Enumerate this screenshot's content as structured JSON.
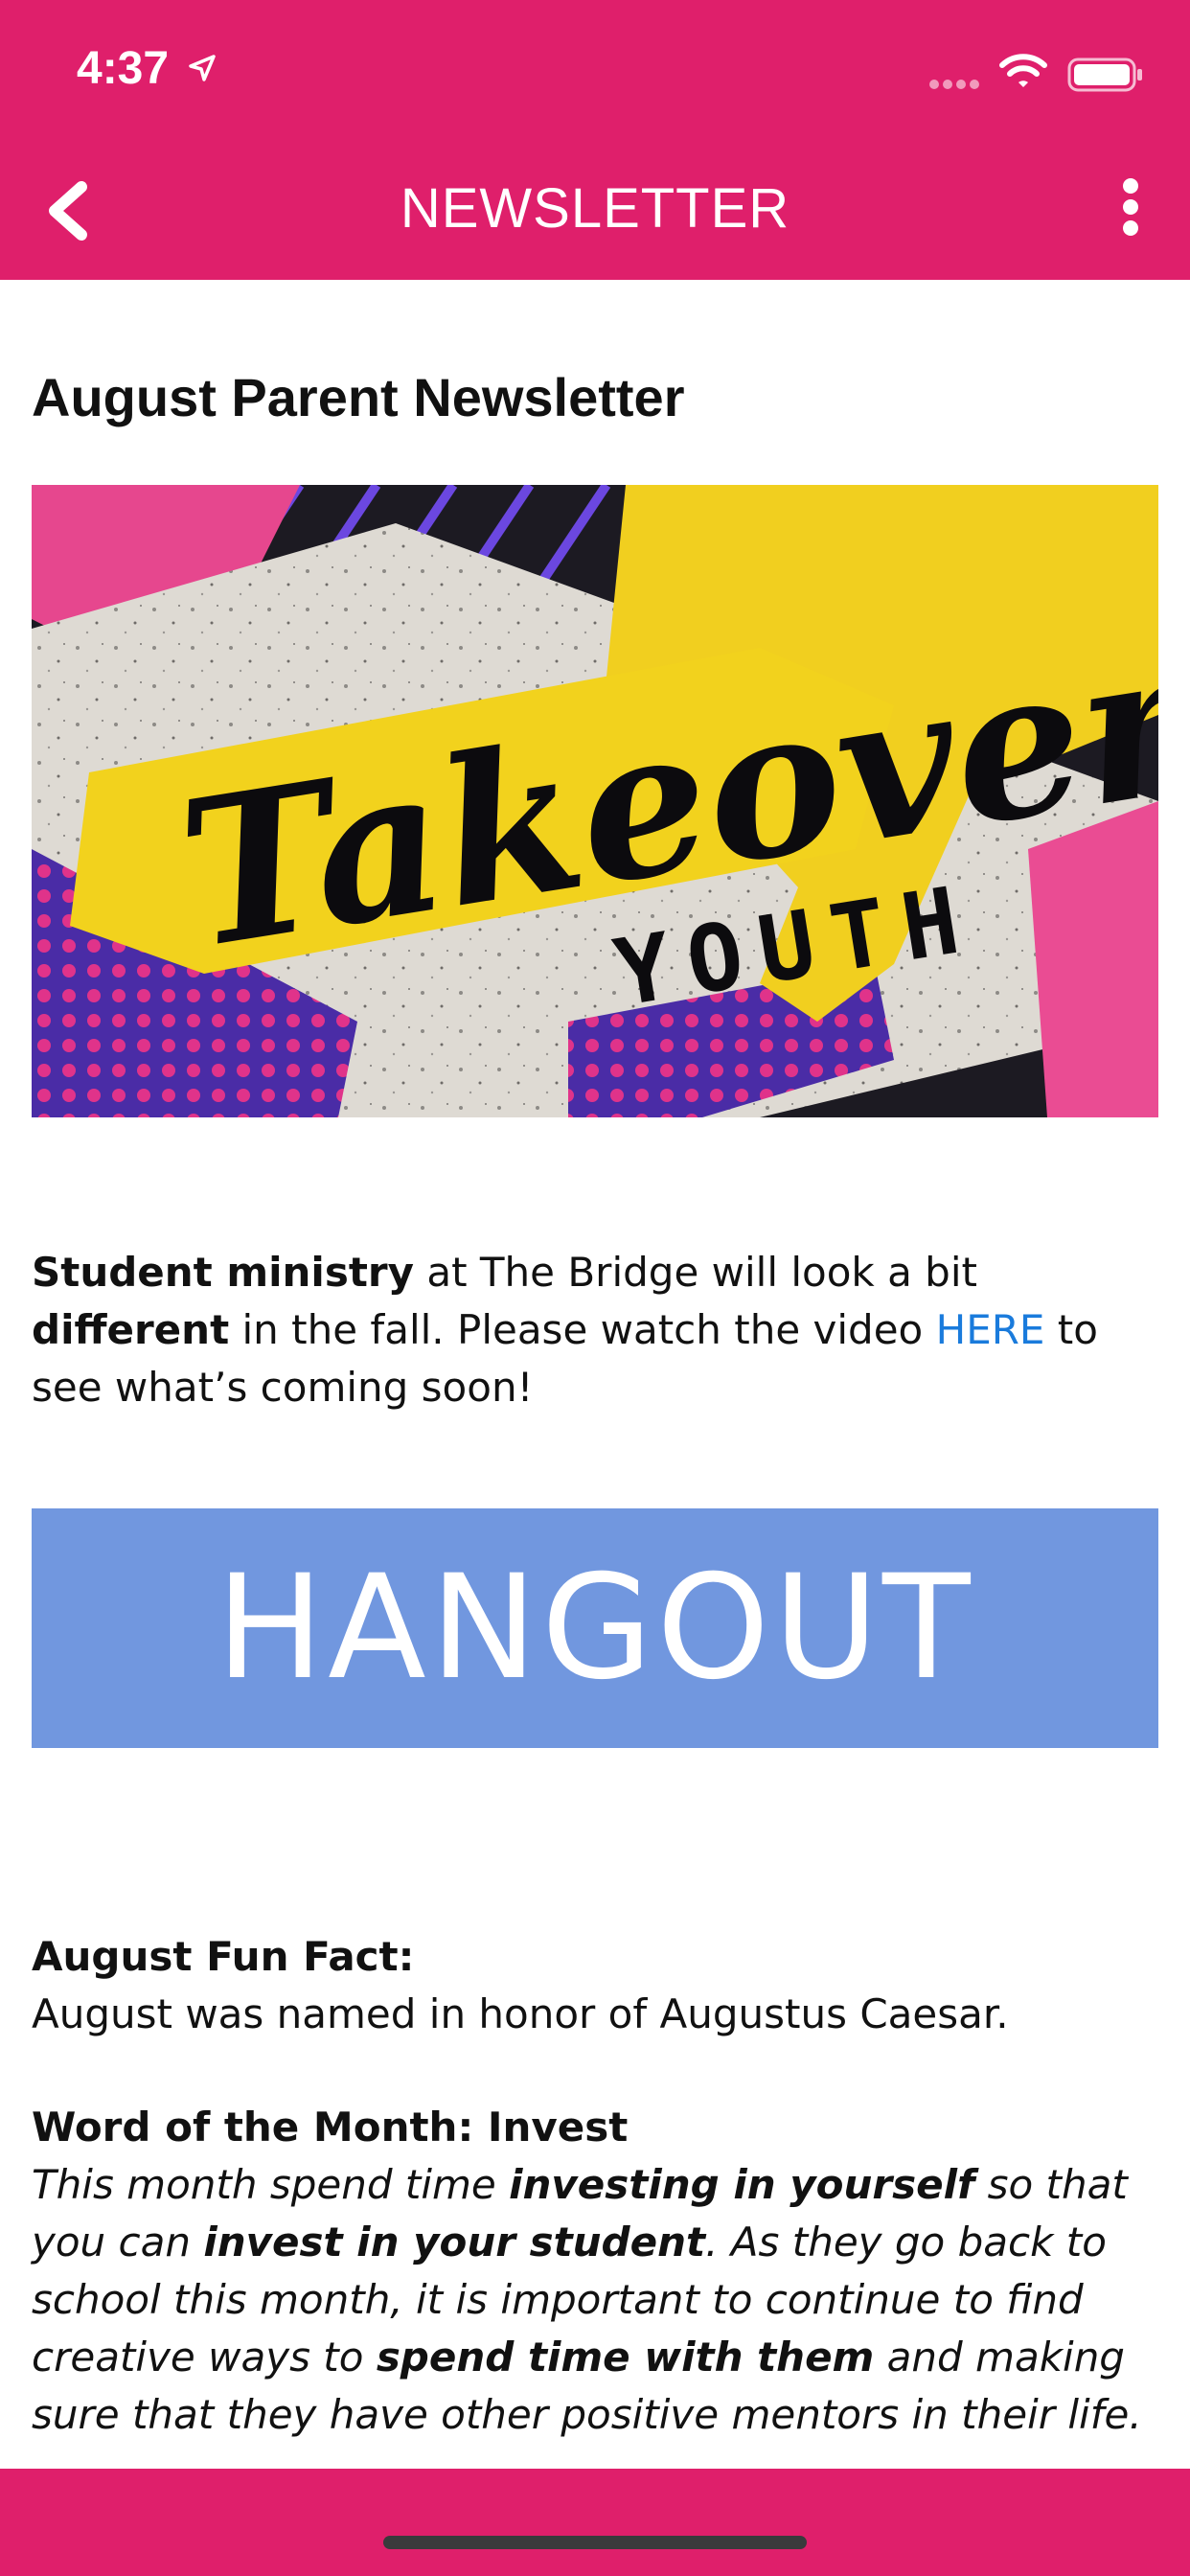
{
  "status_bar": {
    "time": "4:37"
  },
  "nav": {
    "title": "NEWSLETTER",
    "back_icon": "chevron-left-icon",
    "menu_icon": "more-vertical-icon"
  },
  "article": {
    "title": "August Parent Newsletter",
    "banner": {
      "line1": "Takeover",
      "line2": "YOUTH"
    },
    "intro": {
      "b1": "Student ministry",
      "t1": " at The Bridge will look a bit ",
      "b2": "different",
      "t2": " in the fall. Please watch the video ",
      "link": "HERE",
      "t3": " to see what’s coming soon!"
    },
    "hangout_label": "HANGOUT",
    "fun_fact": {
      "heading": "August Fun Fact:",
      "text": "August was named in honor of Augustus Caesar."
    },
    "word": {
      "heading": "Word of the Month: Invest",
      "t1": "This month spend time ",
      "b1": "investing in yourself",
      "t2": " so that you can ",
      "b2": "invest in your student",
      "t3": ". As they go back to school this month, it is important to continue to find creative ways to ",
      "b3": "spend time with them",
      "t4": " and making sure that they have other positive mentors in their life."
    }
  },
  "colors": {
    "brand": "#df1f6b",
    "hangout_bg": "#7197df",
    "link": "#1a7bdc"
  }
}
